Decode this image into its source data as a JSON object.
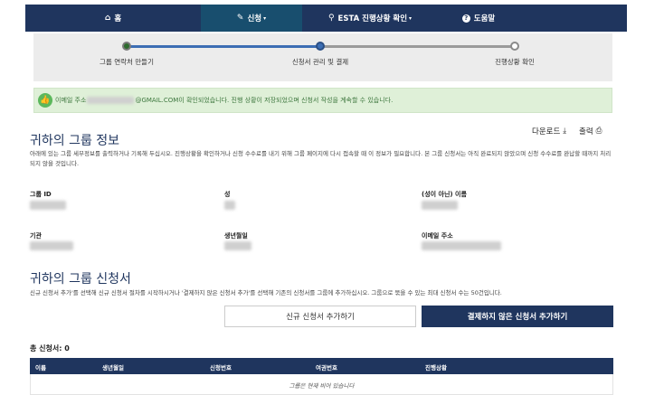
{
  "nav": {
    "items": [
      {
        "icon": "home-icon",
        "glyph": "⌂",
        "label": "홈",
        "caret": false
      },
      {
        "icon": "pencil-icon",
        "glyph": "✎",
        "label": "신청",
        "caret": true
      },
      {
        "icon": "search-icon",
        "glyph": "⚲",
        "label": "ESTA 진행상황 확인",
        "caret": true
      },
      {
        "icon": "question-circle-icon",
        "glyph": "?",
        "label": "도움말",
        "caret": false
      }
    ],
    "active_index": 1,
    "colors": {
      "bar": "#1f355e",
      "active": "#184e6e"
    }
  },
  "progress": {
    "steps": [
      {
        "label": "그룹 연락처 만들기",
        "state": "done"
      },
      {
        "label": "신청서 관리 및 결제",
        "state": "current"
      },
      {
        "label": "진행상황 확인",
        "state": "pending"
      }
    ],
    "colors": {
      "done": "#2e6b2e",
      "current": "#3c6eb4",
      "pending": "#ffffff"
    }
  },
  "alert": {
    "prefix": "이메일 주소",
    "suffix": "@GMAIL.COM이 확인되었습니다. 진행 상황이 저장되었으며 신청서 작성을 계속할 수 있습니다."
  },
  "group_info": {
    "download_label": "다운로드",
    "print_label": "출력",
    "title": "귀하의 그룹 정보",
    "description": "아래에 있는 그룹 세부정보를 출력하거나 기록해 두십시오. 진행상황을 확인하거나 신청 수수료를 내기 위해 그룹 페이지에 다시 접속할 때 이 정보가 필요합니다. 본 그룹 신청서는 아직 완료되지 않았으며 신청 수수료를 완납할 때까지 처리되지 않을 것입니다.",
    "fields": [
      {
        "label": "그룹 ID"
      },
      {
        "label": "성"
      },
      {
        "label": "(성이 아닌) 이름"
      },
      {
        "label": "기관"
      },
      {
        "label": "생년월일"
      },
      {
        "label": "이메일 주소"
      }
    ]
  },
  "applications": {
    "title": "귀하의 그룹 신청서",
    "description": "신규 신청서 추가'를 선택해 신규 신청서 절차를 시작하시거나 '결제하지 않은 신청서 추가'를 선택해 기존의 신청서를 그룹에 추가하십시오. 그룹으로 묶을 수 있는 최대 신청서 수는 50건입니다.",
    "add_new_label": "신규 신청서 추가하기",
    "add_unpaid_label": "결제하지 않은 신청서 추가하기",
    "total_label": "총 신청서: 0",
    "columns": [
      "이름",
      "생년월일",
      "신청번호",
      "여권번호",
      "진행상황"
    ],
    "empty_text": "그룹은 현재 비어 있습니다"
  }
}
